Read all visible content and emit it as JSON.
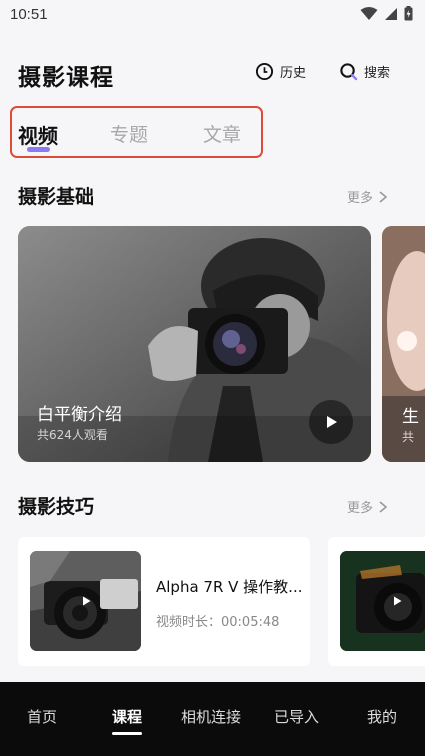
{
  "status_bar": {
    "time": "10:51"
  },
  "header": {
    "title": "摄影课程",
    "history_label": "历史",
    "search_label": "搜索"
  },
  "tabs": [
    {
      "label": "视频",
      "active": true
    },
    {
      "label": "专题",
      "active": false
    },
    {
      "label": "文章",
      "active": false
    }
  ],
  "sections": {
    "basics": {
      "title": "摄影基础",
      "more_label": "更多",
      "cards": [
        {
          "title": "白平衡介绍",
          "views": "共624人观看"
        },
        {
          "title": "生",
          "views": "共"
        }
      ]
    },
    "tips": {
      "title": "摄影技巧",
      "more_label": "更多",
      "cards": [
        {
          "title": "Alpha 7R V 操作教...",
          "duration": "视频时长：00:05:48"
        }
      ]
    }
  },
  "bottom_nav": {
    "items": [
      {
        "label": "首页",
        "active": false
      },
      {
        "label": "课程",
        "active": true
      },
      {
        "label": "相机连接",
        "active": false
      },
      {
        "label": "已导入",
        "active": false
      },
      {
        "label": "我的",
        "active": false
      }
    ]
  },
  "colors": {
    "accent": "#8a7bf0",
    "highlight_frame": "#e04b37",
    "nav_background": "#0b0b0b",
    "page_background": "#f6f6f8"
  },
  "icons": [
    "wifi-icon",
    "signal-icon",
    "battery-icon",
    "clock-icon",
    "search-icon",
    "chevron-right-icon",
    "play-icon"
  ]
}
